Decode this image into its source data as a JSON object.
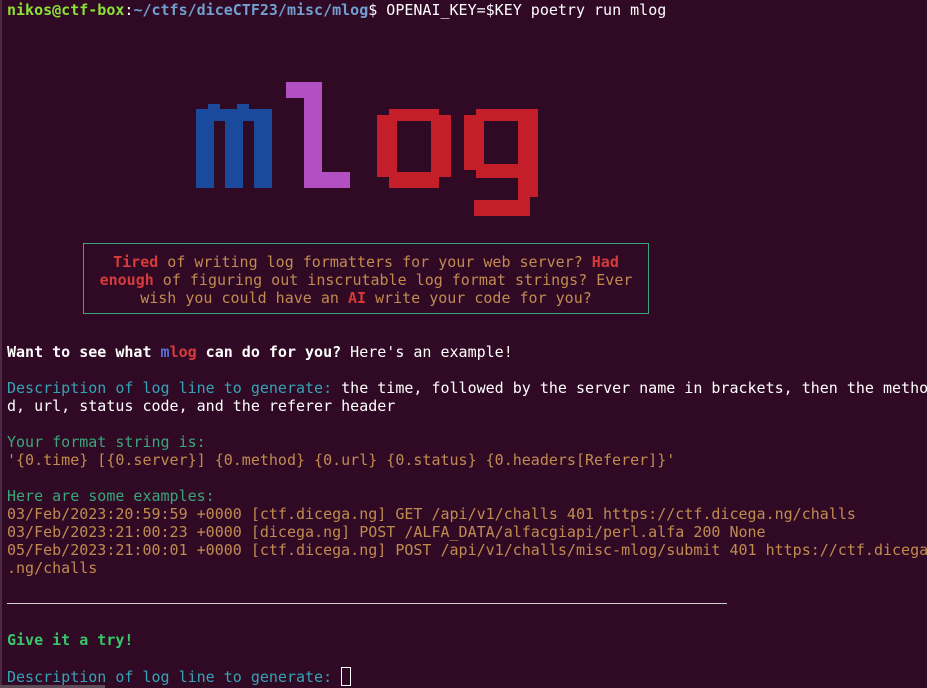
{
  "prompt": {
    "user_host": "nikos@ctf-box",
    "sep": ":",
    "path": "~/ctfs/diceCTF23/misc/mlog",
    "dollar": "$",
    "command": " OPENAI_KEY=$KEY poetry run mlog"
  },
  "logo": {
    "colors": {
      "m": "#1a4a9c",
      "l": "#b24fc2",
      "og": "#c41e2a"
    }
  },
  "intro_box": {
    "w1": "Tired",
    "t1": " of writing log formatters for your web server? ",
    "w2": "Had",
    "w3": "enough",
    "t2": " of figuring out inscrutable log format strings? Ever",
    "t3a": "wish you could have an ",
    "w4": "AI",
    "t3b": " write your code for you?"
  },
  "headline": {
    "a": "Want to see what ",
    "m": "m",
    "log": "log",
    "b": " can do for you?",
    "c": " Here's an example!"
  },
  "example": {
    "desc_label": "Description of log line to generate:",
    "desc_value_1": " the time, followed by the server name in brackets, then the metho",
    "desc_value_2": "d, url, status code, and the referer header",
    "format_label": "Your format string is:",
    "format_value": "'{0.time} [{0.server}] {0.method} {0.url} {0.status} {0.headers[Referer]}'",
    "examples_label": "Here are some examples:",
    "examples": [
      "03/Feb/2023:20:59:59 +0000 [ctf.dicega.ng] GET /api/v1/challs 401 https://ctf.dicega.ng/challs",
      "03/Feb/2023:21:00:23 +0000 [dicega.ng] POST /ALFA_DATA/alfacgiapi/perl.alfa 200 None",
      "05/Feb/2023:21:00:01 +0000 [ctf.dicega.ng] POST /api/v1/challs/misc-mlog/submit 401 https://ctf.dicega",
      ".ng/challs"
    ]
  },
  "try": {
    "label": "Give it a try!",
    "desc_label": "Description of log line to generate:"
  }
}
